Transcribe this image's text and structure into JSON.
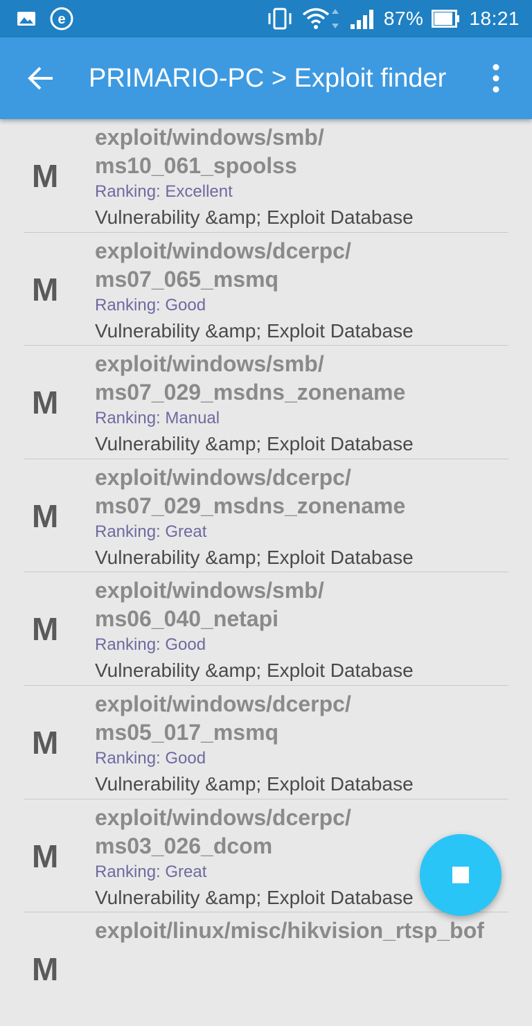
{
  "status_bar": {
    "left_icons": [
      "gallery-icon",
      "e-app-icon"
    ],
    "right_icons": [
      "vibrate-icon",
      "wifi-icon",
      "signal-icon",
      "battery-icon"
    ],
    "battery": "87%",
    "time": "18:21",
    "color": "#1f80c3"
  },
  "app_bar": {
    "title": "PRIMARIO-PC > Exploit finder",
    "color": "#3d9ae0"
  },
  "items": [
    {
      "badge": "M",
      "name_line1": "exploit/windows/smb/",
      "name_line2": "ms10_061_spoolss",
      "ranking": "Ranking: Excellent",
      "source": "Vulnerability &amp; Exploit Database"
    },
    {
      "badge": "M",
      "name_line1": "exploit/windows/dcerpc/",
      "name_line2": "ms07_065_msmq",
      "ranking": "Ranking: Good",
      "source": "Vulnerability &amp; Exploit Database"
    },
    {
      "badge": "M",
      "name_line1": "exploit/windows/smb/",
      "name_line2": "ms07_029_msdns_zonename",
      "ranking": "Ranking: Manual",
      "source": "Vulnerability &amp; Exploit Database"
    },
    {
      "badge": "M",
      "name_line1": "exploit/windows/dcerpc/",
      "name_line2": "ms07_029_msdns_zonename",
      "ranking": "Ranking: Great",
      "source": "Vulnerability &amp; Exploit Database"
    },
    {
      "badge": "M",
      "name_line1": "exploit/windows/smb/",
      "name_line2": "ms06_040_netapi",
      "ranking": "Ranking: Good",
      "source": "Vulnerability &amp; Exploit Database"
    },
    {
      "badge": "M",
      "name_line1": "exploit/windows/dcerpc/",
      "name_line2": "ms05_017_msmq",
      "ranking": "Ranking: Good",
      "source": "Vulnerability &amp; Exploit Database"
    },
    {
      "badge": "M",
      "name_line1": "exploit/windows/dcerpc/",
      "name_line2": "ms03_026_dcom",
      "ranking": "Ranking: Great",
      "source": "Vulnerability &amp; Exploit Database"
    },
    {
      "badge": "M",
      "name_line1": "exploit/linux/misc/hikvision_rtsp_bof",
      "name_line2": "",
      "ranking": "",
      "source": ""
    }
  ],
  "fab": {
    "icon": "stop-icon",
    "color": "#29c5f6"
  }
}
